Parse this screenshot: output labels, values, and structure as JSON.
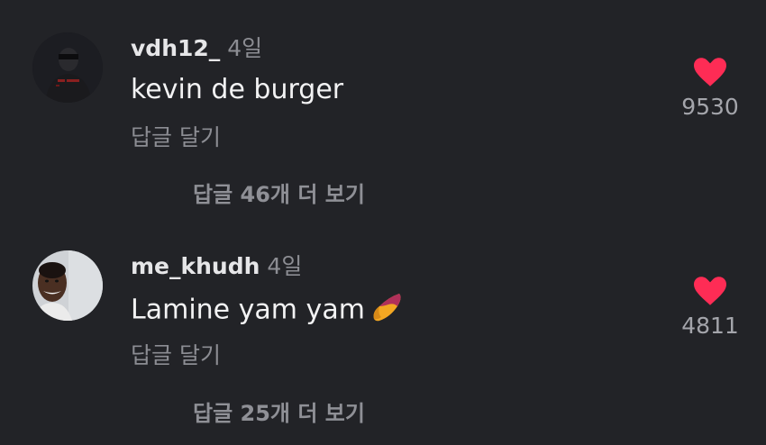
{
  "comments": [
    {
      "username": "vdh12_",
      "time": "4일",
      "text": "kevin de burger",
      "reply_label": "답글 달기",
      "likes": "9530",
      "view_replies": "답글 46개 더 보기",
      "avatar_icon": "profile-photo"
    },
    {
      "username": "me_khudh",
      "time": "4일",
      "text": "Lamine yam yam",
      "emoji": "sweet-potato-emoji",
      "reply_label": "답글 달기",
      "likes": "4811",
      "view_replies": "답글 25개 더 보기",
      "avatar_icon": "profile-photo"
    }
  ],
  "colors": {
    "background": "#222327",
    "heart": "#fe2c55",
    "secondary_text": "#8c8d93"
  }
}
